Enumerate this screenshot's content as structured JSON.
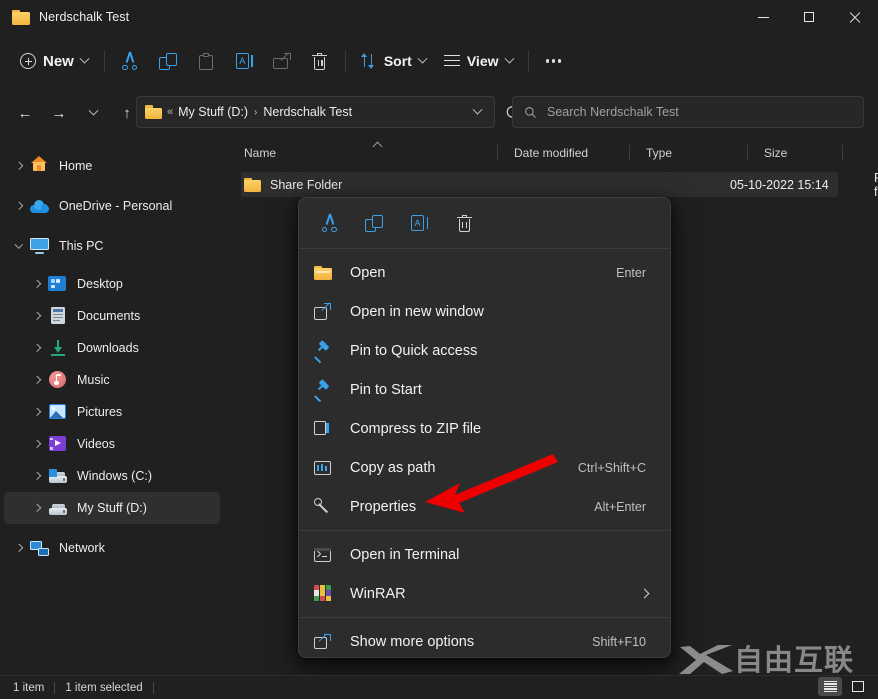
{
  "window": {
    "title": "Nerdschalk Test",
    "controls": {
      "minimize": "Minimize",
      "maximize": "Maximize",
      "close": "Close"
    }
  },
  "toolbar": {
    "new_label": "New",
    "cut_label": "Cut",
    "copy_label": "Copy",
    "paste_label": "Paste",
    "rename_label": "Rename",
    "share_label": "Share",
    "delete_label": "Delete",
    "sort_label": "Sort",
    "view_label": "View",
    "more_label": "See more"
  },
  "navigation": {
    "back": "Back",
    "forward": "Forward",
    "recent": "Recent locations",
    "up": "Up to My Stuff (D:)",
    "refresh": "Refresh"
  },
  "address": {
    "overflow": "«",
    "crumbs": [
      "My Stuff (D:)",
      "Nerdschalk Test"
    ],
    "separator": "›"
  },
  "search": {
    "placeholder": "Search Nerdschalk Test"
  },
  "sidebar": {
    "items": [
      {
        "label": "Home",
        "icon": "home-icon",
        "indent": 0,
        "chevron": "collapsed",
        "selected": false
      },
      {
        "label": "OneDrive - Personal",
        "icon": "onedrive-icon",
        "indent": 0,
        "chevron": "collapsed",
        "selected": false
      },
      {
        "label": "This PC",
        "icon": "this-pc-icon",
        "indent": 0,
        "chevron": "expanded",
        "selected": false
      },
      {
        "label": "Desktop",
        "icon": "desktop-icon",
        "indent": 1,
        "chevron": "collapsed",
        "selected": false
      },
      {
        "label": "Documents",
        "icon": "documents-icon",
        "indent": 1,
        "chevron": "collapsed",
        "selected": false
      },
      {
        "label": "Downloads",
        "icon": "downloads-icon",
        "indent": 1,
        "chevron": "collapsed",
        "selected": false
      },
      {
        "label": "Music",
        "icon": "music-icon",
        "indent": 1,
        "chevron": "collapsed",
        "selected": false
      },
      {
        "label": "Pictures",
        "icon": "pictures-icon",
        "indent": 1,
        "chevron": "collapsed",
        "selected": false
      },
      {
        "label": "Videos",
        "icon": "videos-icon",
        "indent": 1,
        "chevron": "collapsed",
        "selected": false
      },
      {
        "label": "Windows (C:)",
        "icon": "drive-windows-icon",
        "indent": 1,
        "chevron": "collapsed",
        "selected": false
      },
      {
        "label": "My Stuff (D:)",
        "icon": "drive-icon",
        "indent": 1,
        "chevron": "collapsed",
        "selected": true
      },
      {
        "label": "Network",
        "icon": "network-icon",
        "indent": 0,
        "chevron": "collapsed",
        "selected": false
      }
    ]
  },
  "file_list": {
    "columns": [
      {
        "label": "Name",
        "sorted": "asc"
      },
      {
        "label": "Date modified",
        "sorted": ""
      },
      {
        "label": "Type",
        "sorted": ""
      },
      {
        "label": "Size",
        "sorted": ""
      }
    ],
    "rows": [
      {
        "name": "Share Folder",
        "date_modified": "05-10-2022 15:14",
        "type": "File folder",
        "size": "",
        "selected": true
      }
    ]
  },
  "context_menu": {
    "icon_row": [
      {
        "name": "cut-icon",
        "label": "Cut"
      },
      {
        "name": "copy-icon",
        "label": "Copy"
      },
      {
        "name": "rename-icon",
        "label": "Rename"
      },
      {
        "name": "delete-icon",
        "label": "Delete"
      }
    ],
    "items": [
      {
        "label": "Open",
        "accel": "Enter",
        "icon": "folder-icon",
        "submenu": false
      },
      {
        "label": "Open in new window",
        "accel": "",
        "icon": "new-window-icon",
        "submenu": false
      },
      {
        "label": "Pin to Quick access",
        "accel": "",
        "icon": "pin-icon",
        "submenu": false
      },
      {
        "label": "Pin to Start",
        "accel": "",
        "icon": "pin-icon",
        "submenu": false
      },
      {
        "label": "Compress to ZIP file",
        "accel": "",
        "icon": "zip-icon",
        "submenu": false
      },
      {
        "label": "Copy as path",
        "accel": "Ctrl+Shift+C",
        "icon": "copy-path-icon",
        "submenu": false
      },
      {
        "label": "Properties",
        "accel": "Alt+Enter",
        "icon": "properties-icon",
        "submenu": false
      },
      {
        "label": "Open in Terminal",
        "accel": "",
        "icon": "terminal-icon",
        "submenu": false
      },
      {
        "label": "WinRAR",
        "accel": "",
        "icon": "winrar-icon",
        "submenu": true
      },
      {
        "label": "Show more options",
        "accel": "Shift+F10",
        "icon": "show-more-icon",
        "submenu": false
      }
    ]
  },
  "status_bar": {
    "item_count": "1 item",
    "selection": "1 item selected",
    "view_details": "Details view",
    "view_large_icons": "Large icons view"
  },
  "annotation": {
    "arrow_color": "#ee0000",
    "points_at": "Properties"
  },
  "watermark": {
    "text": "自由互联",
    "logo": "x-logo"
  },
  "colors": {
    "window_bg": "#202020",
    "menu_bg": "#2c2c2c",
    "accent_blue": "#3aa0e8",
    "folder_yellow": "#f1b13a",
    "selection_bg": "#2e2e2e"
  }
}
